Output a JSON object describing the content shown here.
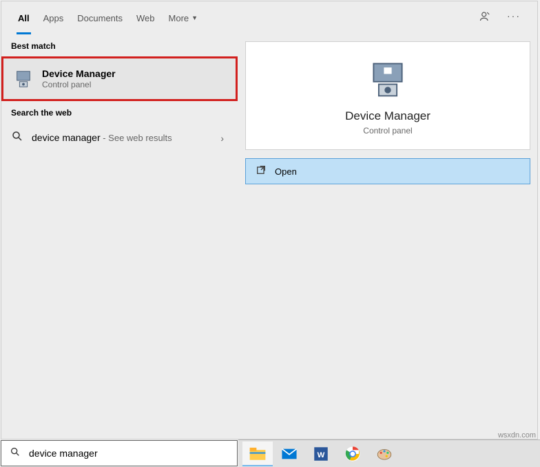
{
  "tabs": {
    "all": "All",
    "apps": "Apps",
    "documents": "Documents",
    "web": "Web",
    "more": "More"
  },
  "sections": {
    "best_match": "Best match",
    "search_web": "Search the web"
  },
  "result": {
    "title": "Device Manager",
    "subtitle": "Control panel"
  },
  "web": {
    "query": "device manager",
    "suffix": " - See web results"
  },
  "detail": {
    "title": "Device Manager",
    "subtitle": "Control panel"
  },
  "open": {
    "label": "Open"
  },
  "search": {
    "value": "device manager"
  },
  "watermark": "wsxdn.com"
}
